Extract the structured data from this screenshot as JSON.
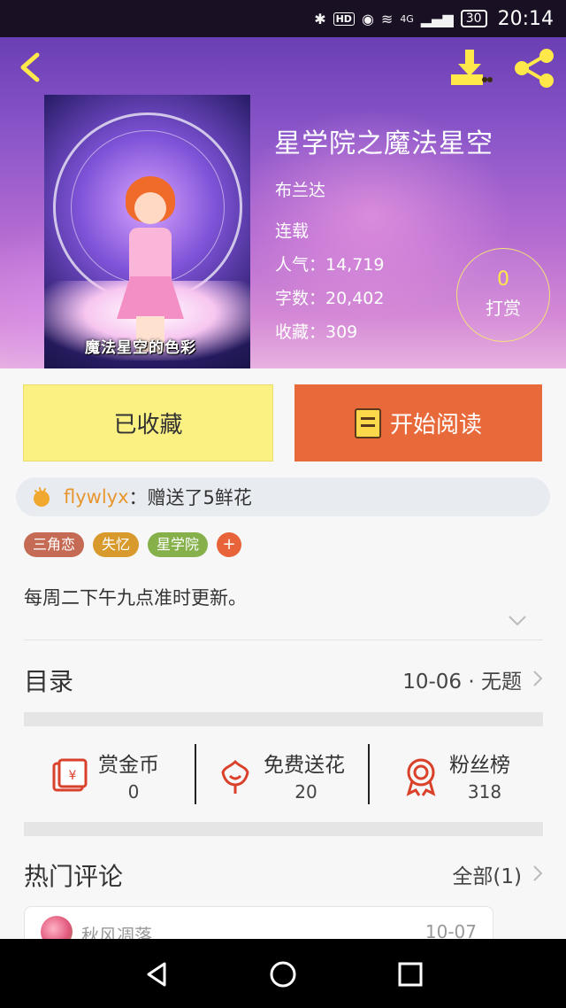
{
  "status_bar": {
    "hd": "HD",
    "network": "4G",
    "battery": "30",
    "time": "20:14"
  },
  "header": {
    "icons": [
      "back-arrow",
      "download",
      "share"
    ],
    "cover_text": "魔法星空的色彩",
    "title": "星学院之魔法星空",
    "author": "布兰达",
    "status": "连载",
    "popularity": "人气：14,719",
    "word_count": "字数：20,402",
    "favorites": "收藏：309",
    "reward": {
      "count": "0",
      "label": "打赏"
    }
  },
  "actions": {
    "collected_label": "已收藏",
    "read_label": "开始阅读"
  },
  "gift": {
    "user": "flywlyx",
    "text": "：赠送了5鲜花"
  },
  "tags": [
    "三角恋",
    "失忆",
    "星学院"
  ],
  "tag_add": "+",
  "description": "每周二下午九点准时更新。",
  "toc": {
    "title": "目录",
    "latest": "10-06 · 无题"
  },
  "stats": [
    {
      "label": "赏金币",
      "value": "0",
      "icon": "red-envelope-icon"
    },
    {
      "label": "免费送花",
      "value": "20",
      "icon": "flower-icon"
    },
    {
      "label": "粉丝榜",
      "value": "318",
      "icon": "award-ribbon-icon"
    }
  ],
  "hot_comments": {
    "title": "热门评论",
    "all_label": "全部(1)"
  },
  "comment": {
    "user": "秋风凋落",
    "date": "10-07"
  },
  "colors": {
    "accent_yellow": "#ffe94a",
    "read_button": "#e86a3b",
    "collected_button": "#fbf183",
    "icon_red": "#d9412b"
  }
}
